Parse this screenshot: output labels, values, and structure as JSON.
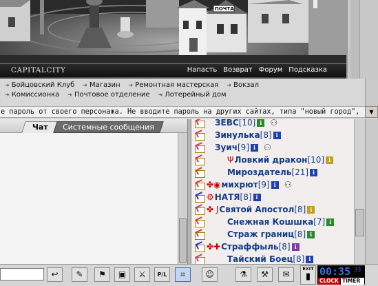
{
  "header": {
    "city_title": "CAPITALCITY",
    "sign_text": "ПОЧТА",
    "menu": [
      "Напасть",
      "Возврат",
      "Форум",
      "Подсказка"
    ]
  },
  "locations": {
    "row1": [
      "Бойцовский Клуб",
      "Магазин",
      "Ремонтная мастерская",
      "Вокзал"
    ],
    "row2": [
      "Комиссионка",
      "Почтовое отделение",
      "Лотерейный дом"
    ]
  },
  "warning": "е пароль от своего персонажа. Не вводите пароль на других сайтах, типа \"новый город\",",
  "chat": {
    "tabs": [
      "Чат",
      "Системные сообщения"
    ]
  },
  "users": [
    {
      "name": "ЗЕВС",
      "level": "[10]",
      "pm": "red",
      "info": "g",
      "gear": true,
      "indent": 1
    },
    {
      "name": "Зинулька",
      "level": "[8]",
      "pm": "red",
      "info": "b",
      "indent": 1
    },
    {
      "name": "Зуич",
      "level": "[9]",
      "pm": "red",
      "info": "b",
      "gear": true,
      "indent": 1
    },
    {
      "name": "Ловкий дракон",
      "level": "[10]",
      "pm": "red",
      "info": "y",
      "clan": "Ψ",
      "indent": 2
    },
    {
      "name": "Мироздатель",
      "level": "[21]",
      "pm": "red",
      "info": "b",
      "indent": 2
    },
    {
      "name": "михрют",
      "level": "[9]",
      "pm": "red",
      "info": "b",
      "gear": true,
      "clan": "✤◉",
      "indent": 0
    },
    {
      "name": "НАТЯ",
      "level": "[8]",
      "pm": "blue",
      "info": "b",
      "clan": "⚙",
      "indent": 0
    },
    {
      "name": "Святой Апостол",
      "level": "[8]",
      "pm": "red",
      "info": "y",
      "clan": "✤ J",
      "indent": 0
    },
    {
      "name": "Снежная Кошшка",
      "level": "[7]",
      "pm": "red",
      "info": "g",
      "indent": 2
    },
    {
      "name": "Страж границ",
      "level": "[8]",
      "pm": "red",
      "info": "g",
      "indent": 2
    },
    {
      "name": "Страффыль",
      "level": "[8]",
      "pm": "blue",
      "info": "p",
      "clan": "✤✚",
      "indent": 0
    },
    {
      "name": "Тайский Боец",
      "level": "[8]",
      "pm": "red",
      "info": "b",
      "indent": 2
    }
  ],
  "toolbar": {
    "exit_label": "EXIT",
    "buttons": [
      "↩",
      "✎",
      "⚑",
      "▣",
      "⚔",
      "P/L",
      "⌗",
      "☺",
      "⚗",
      "⚒",
      "✉"
    ]
  },
  "clock": {
    "time": "00:35",
    "seconds": "33",
    "label_clock": "CLOCK",
    "label_timer": "TIMER"
  },
  "colors": {
    "user_name": "#123c86",
    "clock_digits": "#3b6ed6",
    "clock_label": "#cc0000"
  }
}
